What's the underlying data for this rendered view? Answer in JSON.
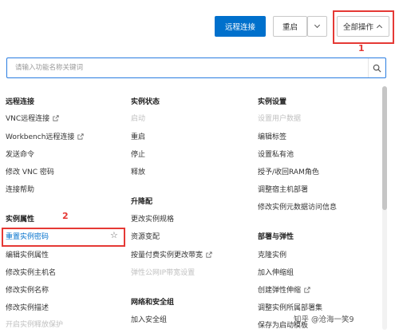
{
  "toolbar": {
    "remote_label": "远程连接",
    "restart_label": "重启",
    "all_ops_label": "全部操作"
  },
  "annotations": {
    "marker1": "1",
    "marker2": "2"
  },
  "search": {
    "placeholder": "请输入功能名称关键词"
  },
  "col1": {
    "groups": [
      {
        "title": "远程连接",
        "items": [
          "VNC远程连接",
          "Workbench远程连接",
          "发送命令",
          "修改 VNC 密码",
          "连接帮助"
        ]
      },
      {
        "title": "实例属性",
        "items": [
          "重置实例密码",
          "编辑实例属性",
          "修改实例主机名",
          "修改实例名称",
          "修改实例描述",
          "开启实例释放保护"
        ]
      }
    ]
  },
  "col2": {
    "groups": [
      {
        "title": "实例状态",
        "items": [
          "启动",
          "重启",
          "停止",
          "释放"
        ]
      },
      {
        "title": "升降配",
        "items": [
          "更改实例规格",
          "资源变配",
          "按量付费实例更改带宽",
          "弹性公网IP带宽设置"
        ]
      },
      {
        "title": "网络和安全组",
        "items": [
          "加入安全组"
        ]
      }
    ]
  },
  "col3": {
    "groups": [
      {
        "title": "实例设置",
        "items": [
          "设置用户数据",
          "编辑标签",
          "设置私有池",
          "授予/收回RAM角色",
          "调整宿主机部署",
          "修改实例元数据访问信息"
        ]
      },
      {
        "title": "部署与弹性",
        "items": [
          "克隆实例",
          "加入伸缩组",
          "创建弹性伸缩",
          "调整实例所属部署集",
          "保存为启动模板"
        ]
      }
    ]
  },
  "watermark": "知乎 @沧海一笑9",
  "colors": {
    "primary": "#0070cc",
    "annotation": "#e53935",
    "disabled": "#c0c0c0"
  }
}
